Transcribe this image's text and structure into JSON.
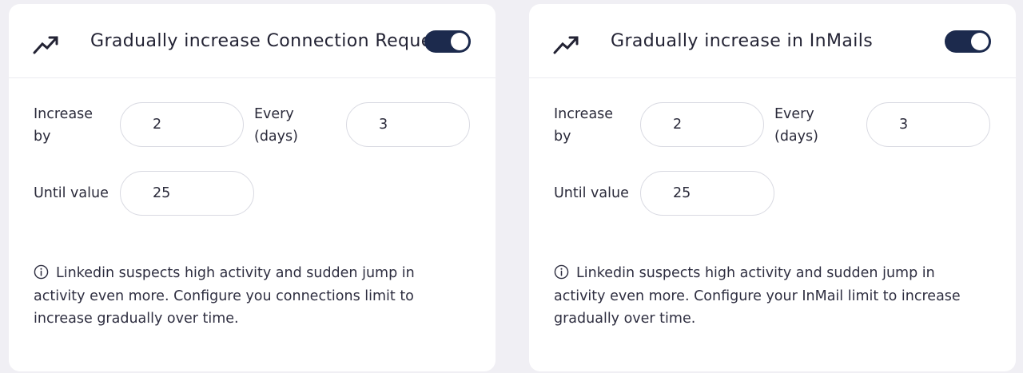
{
  "cards": [
    {
      "title": "Gradually increase Connection Requests",
      "toggle_on": true,
      "increase_by_label": "Increase\nby",
      "increase_by_value": "2",
      "every_label": "Every\n(days)",
      "every_value": "3",
      "until_label": "Until value",
      "until_value": "25",
      "info_text": "Linkedin suspects high activity and sudden jump in activity even more. Configure you connections limit to increase gradually over time."
    },
    {
      "title": "Gradually increase in InMails",
      "toggle_on": true,
      "increase_by_label": "Increase\nby",
      "increase_by_value": "2",
      "every_label": "Every\n(days)",
      "every_value": "3",
      "until_label": "Until value",
      "until_value": "25",
      "info_text": "Linkedin suspects high activity and sudden jump in activity even more. Configure your InMail limit to increase gradually over time."
    }
  ],
  "icons": {
    "header": "trending-up-icon",
    "info": "info-circle-icon"
  },
  "colors": {
    "toggle_on": "#1c2a4d",
    "page_background": "#f0eff4",
    "card_background": "#ffffff"
  }
}
